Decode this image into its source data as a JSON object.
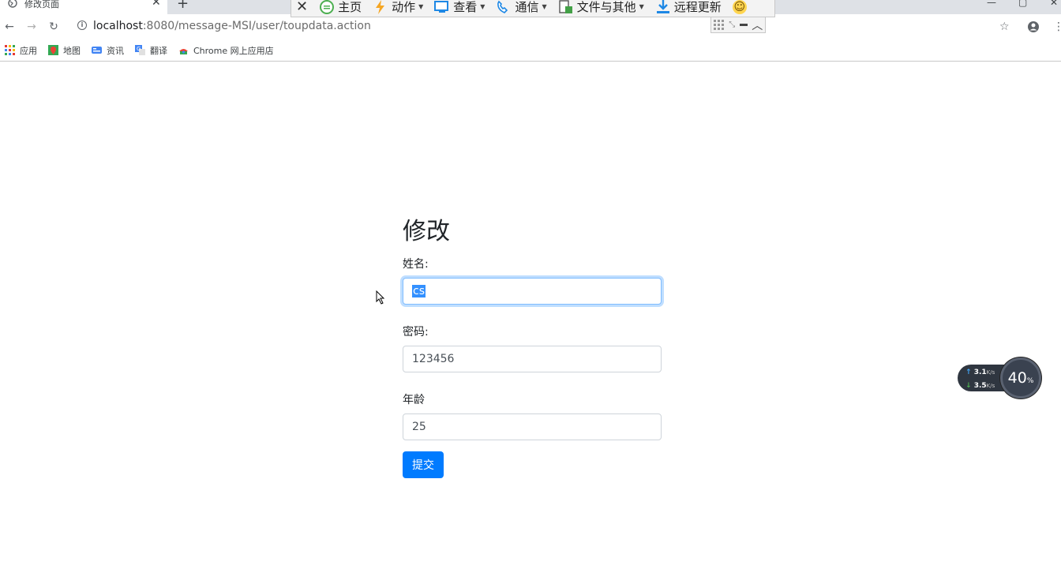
{
  "tab": {
    "title": "修改页面",
    "close": "✕",
    "new": "+"
  },
  "window_controls": {
    "minimize": "—",
    "maximize": "▢",
    "close": "✕"
  },
  "remote_toolbar": {
    "close": "✕",
    "items": [
      {
        "label": "主页",
        "icon": "home-icon",
        "color": "#4caf50"
      },
      {
        "label": "动作",
        "icon": "lightning-icon",
        "color": "#f5a623",
        "dropdown": true
      },
      {
        "label": "查看",
        "icon": "monitor-icon",
        "color": "#1e88e5",
        "dropdown": true
      },
      {
        "label": "通信",
        "icon": "phone-icon",
        "color": "#1e88e5",
        "dropdown": true
      },
      {
        "label": "文件与其他",
        "icon": "file-icon",
        "color": "#43a047",
        "dropdown": true
      },
      {
        "label": "远程更新",
        "icon": "download-icon",
        "color": "#1e88e5"
      }
    ],
    "emoji": "☺"
  },
  "address": {
    "host": "localhost",
    "rest": ":8080/message-MSI/user/toupdata.action"
  },
  "bookmarks": [
    {
      "label": "应用",
      "icon": "apps-grid-icon",
      "color": "#e53935"
    },
    {
      "label": "地图",
      "icon": "maps-icon",
      "color": "#34a853"
    },
    {
      "label": "资讯",
      "icon": "news-icon",
      "color": "#4285f4"
    },
    {
      "label": "翻译",
      "icon": "translate-icon",
      "color": "#4285f4"
    },
    {
      "label": "Chrome 网上应用店",
      "icon": "webstore-icon",
      "color": "#ea4335"
    }
  ],
  "form": {
    "title": "修改",
    "name_label": "姓名:",
    "name_value": "cs",
    "password_label": "密码:",
    "password_value": "123456",
    "age_label": "年龄",
    "age_value": "25",
    "submit_label": "提交"
  },
  "speed_widget": {
    "up": "3.1",
    "down": "3.5",
    "unit": "K/s",
    "percent": "40",
    "percent_sign": "%"
  }
}
